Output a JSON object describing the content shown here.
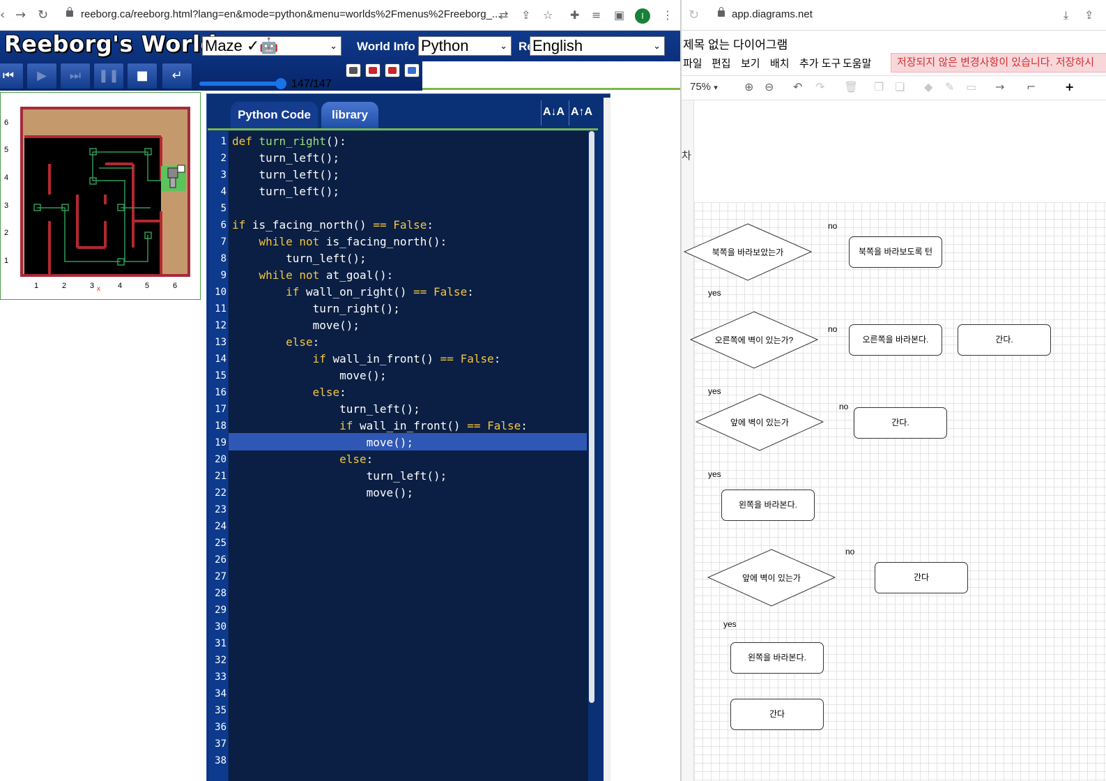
{
  "left_browser": {
    "url": "reeborg.ca/reeborg.html?lang=en&mode=python&menu=worlds%2Fmenus%2Freeborg_...",
    "app_title": "Reeborg's World",
    "world_select": "Maze ✓🤖",
    "world_info_label": "World Info",
    "lang_select": "Python",
    "re_label": "Re",
    "human_lang_select": "English",
    "step_counter": "147/147",
    "tabs": {
      "python_code": "Python Code",
      "library": "library"
    },
    "font_buttons": {
      "decrease": "A↓A",
      "increase": "A↑A"
    },
    "grid_y_labels": [
      "6",
      "5",
      "4",
      "3",
      "2",
      "1"
    ],
    "grid_x_labels": [
      "1",
      "2",
      "3",
      "4",
      "5",
      "6"
    ],
    "x_marker": "x",
    "highlighted_line": 19,
    "line_numbers": [
      "1",
      "2",
      "3",
      "4",
      "5",
      "6",
      "7",
      "8",
      "9",
      "10",
      "11",
      "12",
      "13",
      "14",
      "15",
      "16",
      "17",
      "18",
      "19",
      "20",
      "21",
      "22",
      "23",
      "24",
      "25",
      "26",
      "27",
      "28",
      "29",
      "30",
      "31",
      "32",
      "33",
      "34",
      "35",
      "36",
      "37",
      "38"
    ],
    "code_lines": [
      "def turn_right():",
      "    turn_left();",
      "    turn_left();",
      "    turn_left();",
      "",
      "if is_facing_north() == False:",
      "    while not is_facing_north():",
      "        turn_left();",
      "    while not at_goal():",
      "        if wall_on_right() == False:",
      "            turn_right();",
      "            move();",
      "        else:",
      "            if wall_in_front() == False:",
      "                move();",
      "            else:",
      "                turn_left();",
      "                if wall_in_front() == False:",
      "                    move();",
      "                else:",
      "                    turn_left();",
      "                    move();"
    ]
  },
  "right_browser": {
    "url": "app.diagrams.net",
    "doc_title": "제목 없는 다이어그램",
    "menu": [
      "파일",
      "편집",
      "보기",
      "배치",
      "추가 도구",
      "도움말"
    ],
    "unsaved_notice": "저장되지 않은 변경사항이 있습니다. 저장하시",
    "zoom": "75%",
    "side_char": "차",
    "diagram": {
      "diamonds": [
        "북쪽을 바라보았는가",
        "오른쪽에 벽이 있는가?",
        "앞에 벽이 있는가",
        "앞에 벽이 있는가"
      ],
      "boxes": [
        "북쪽을 바라보도록 턴",
        "오른쪽을 바라본다.",
        "간다.",
        "간다.",
        "왼쪽을 바라본다.",
        "간다",
        "왼쪽을 바라본다.",
        "간다"
      ],
      "labels": {
        "no": "no",
        "yes": "yes"
      }
    }
  }
}
